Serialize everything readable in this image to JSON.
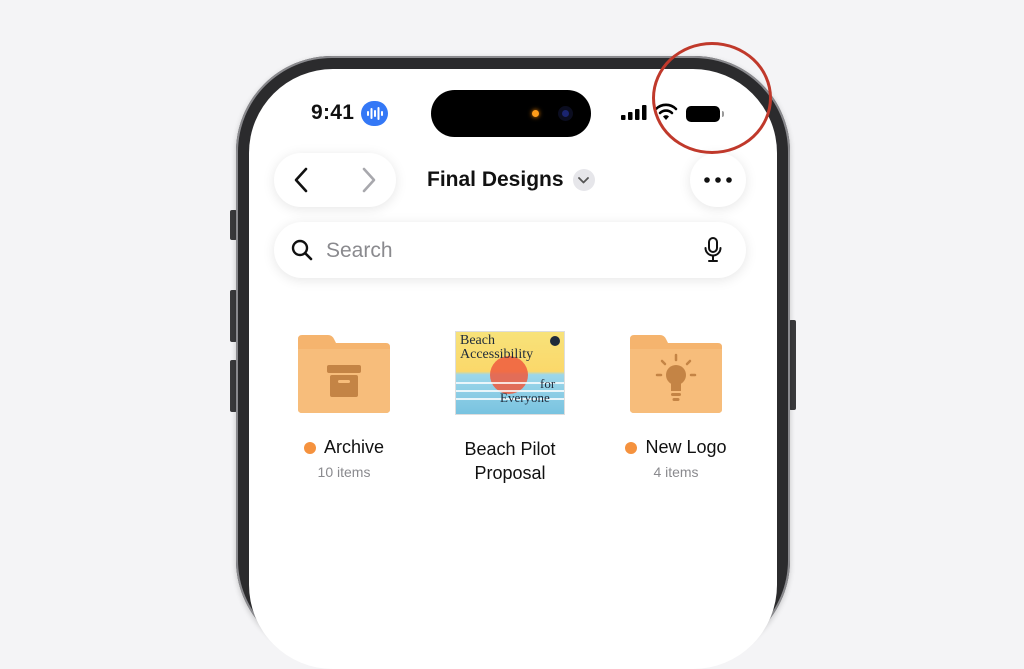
{
  "status_bar": {
    "time": "9:41",
    "icons": [
      "voice-waveform-icon",
      "cellular-signal-icon",
      "wifi-icon",
      "battery-icon"
    ],
    "siri_color": "#3478f6"
  },
  "header": {
    "back_icon": "chevron-left-icon",
    "forward_icon": "chevron-right-icon",
    "title": "Final Designs",
    "title_menu_icon": "chevron-down-icon",
    "more_icon": "ellipsis-icon"
  },
  "search": {
    "placeholder": "Search",
    "value": "",
    "icons": [
      "magnifier-icon",
      "microphone-icon"
    ]
  },
  "items": [
    {
      "name": "Archive",
      "subtitle": "10 items",
      "kind": "folder",
      "icon": "archive-box-icon",
      "tag_color": "#f5923e"
    },
    {
      "name_line1": "Beach Pilot",
      "name_line2": "Proposal",
      "kind": "document",
      "thumbnail_text": [
        "Beach",
        "Accessibility",
        "for",
        "Everyone"
      ]
    },
    {
      "name": "New Logo",
      "subtitle": "4 items",
      "kind": "folder",
      "icon": "lightbulb-icon",
      "tag_color": "#f5923e"
    }
  ],
  "colors": {
    "folder": "#f5b46e",
    "annotation_ring": "#c0392b"
  }
}
